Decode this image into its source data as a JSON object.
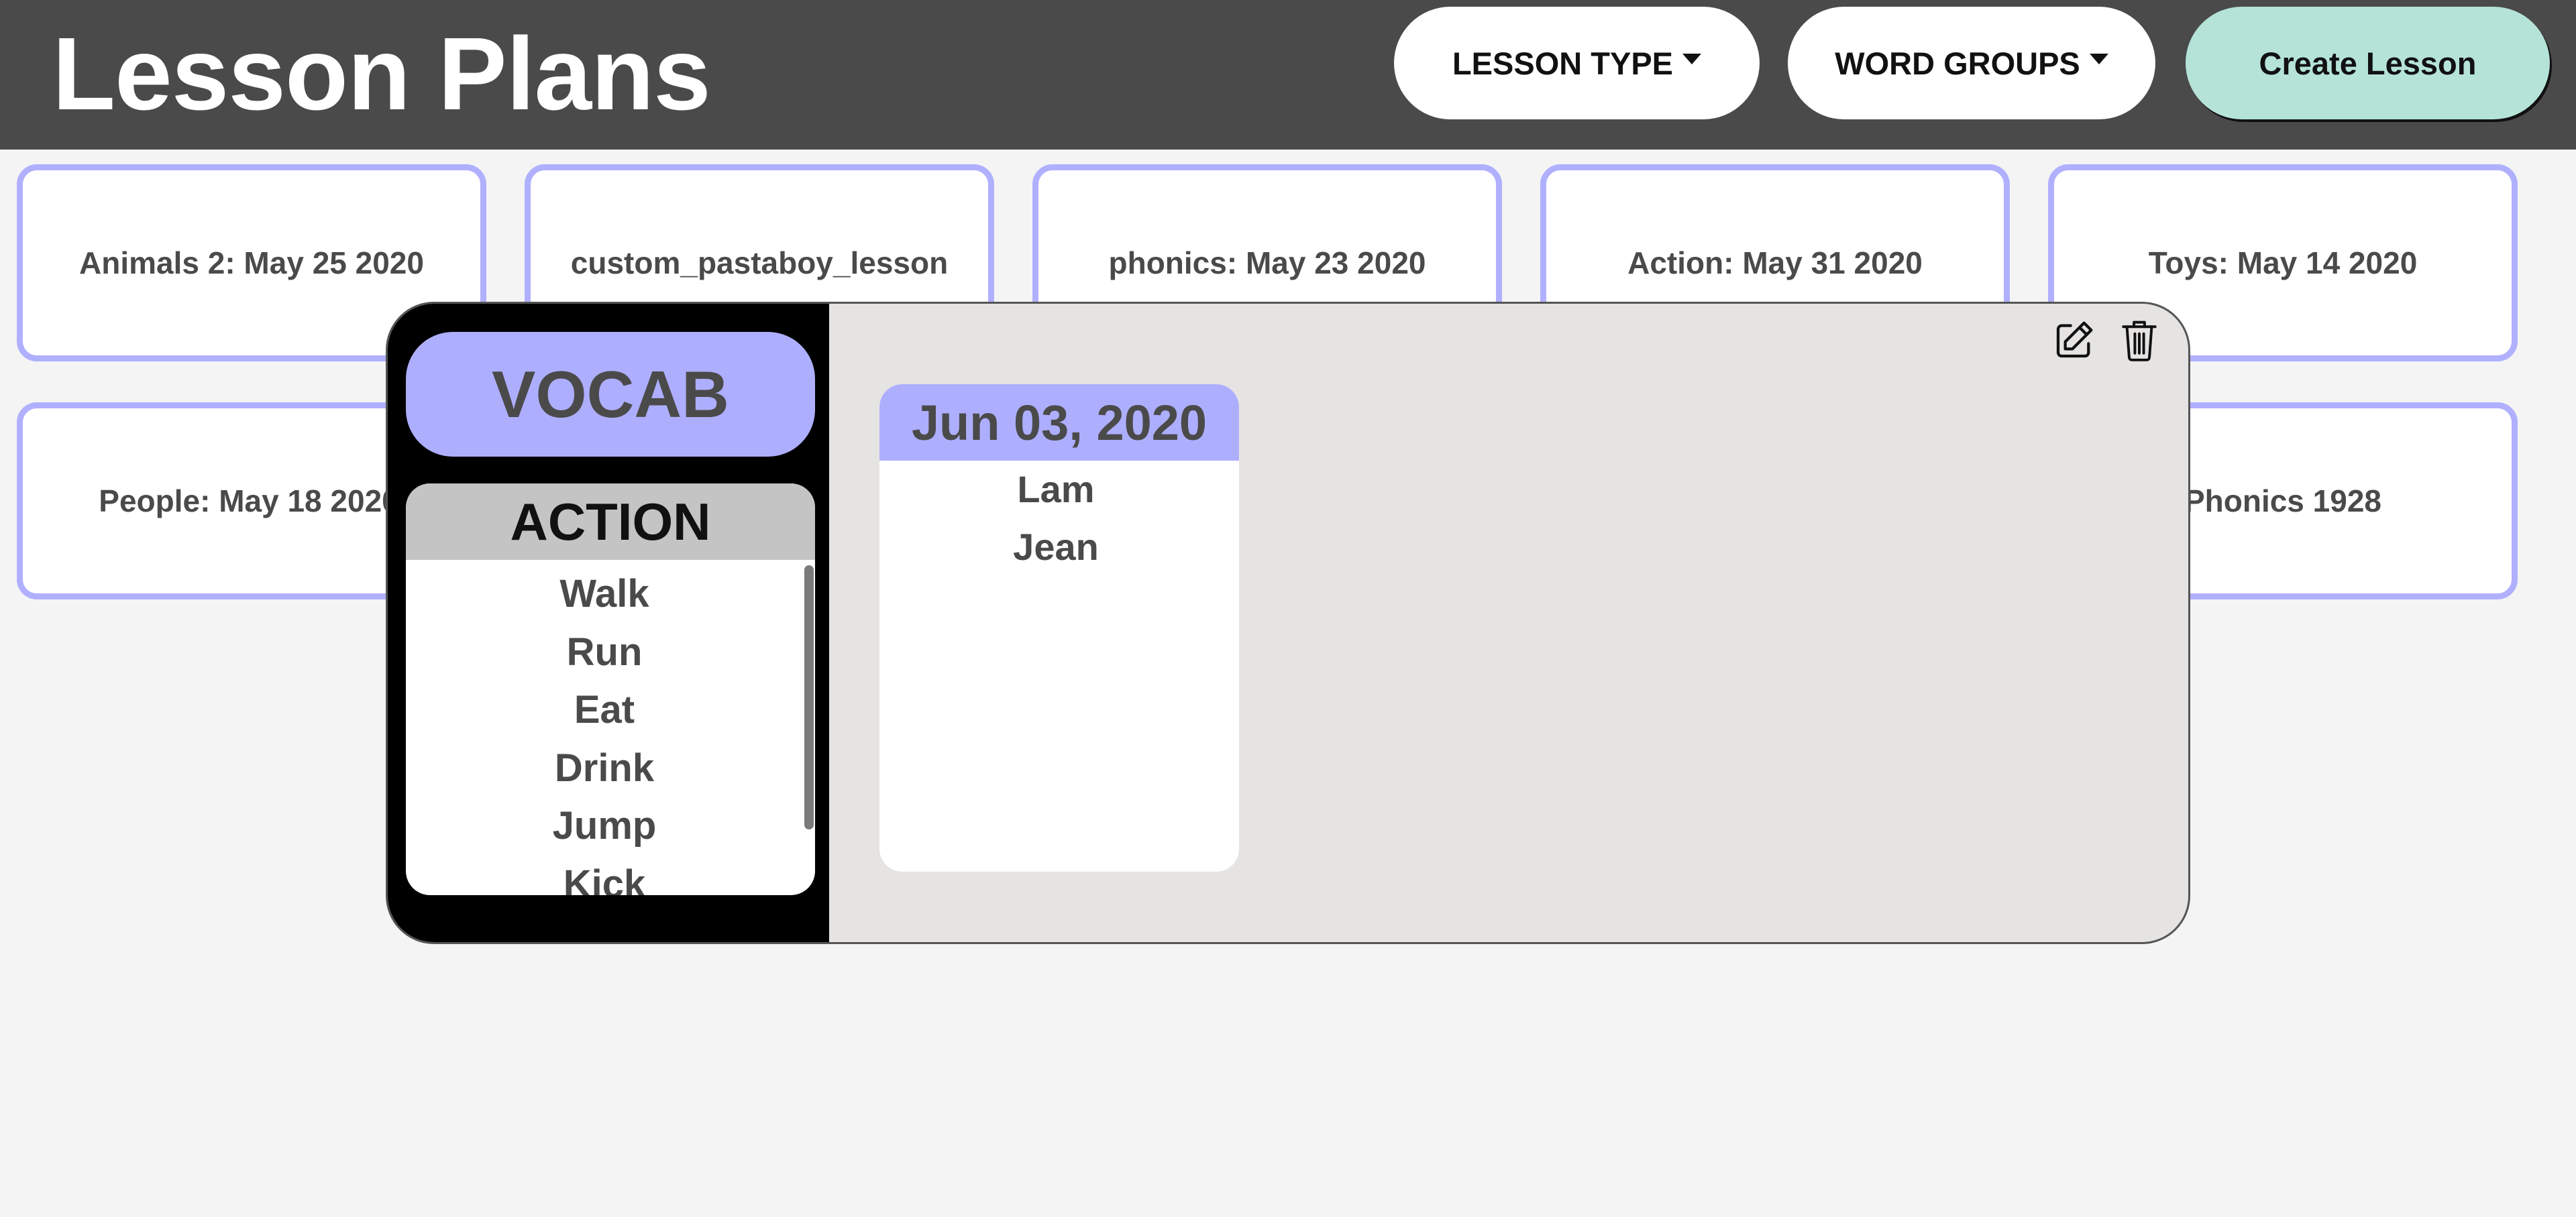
{
  "header": {
    "title": "Lesson Plans",
    "lesson_type_label": "LESSON TYPE",
    "word_groups_label": "WORD GROUPS",
    "create_lesson_label": "Create Lesson"
  },
  "cards": [
    {
      "label": "Animals 2: May 25 2020"
    },
    {
      "label": "custom_pastaboy_lesson"
    },
    {
      "label": "phonics: May 23 2020"
    },
    {
      "label": "Action: May 31 2020"
    },
    {
      "label": "Toys: May 14 2020"
    },
    {
      "label": "People: May 18 2020"
    },
    {
      "label": "Phonics 1928"
    }
  ],
  "modal": {
    "lesson_type": "VOCAB",
    "word_group": {
      "title": "ACTION",
      "words": [
        "Walk",
        "Run",
        "Eat",
        "Drink",
        "Jump",
        "Kick"
      ]
    },
    "session": {
      "date": "Jun 03, 2020",
      "students": [
        "Lam",
        "Jean"
      ]
    },
    "icons": {
      "edit": "edit-icon",
      "delete": "trash-icon"
    }
  },
  "colors": {
    "header_bg": "#4a4a4a",
    "accent_purple": "#aeaeff",
    "card_border": "#b0b0ff",
    "create_button_bg": "#b5e3d8",
    "page_bg": "#f4f4f4",
    "modal_bg": "#e5e4e2"
  }
}
